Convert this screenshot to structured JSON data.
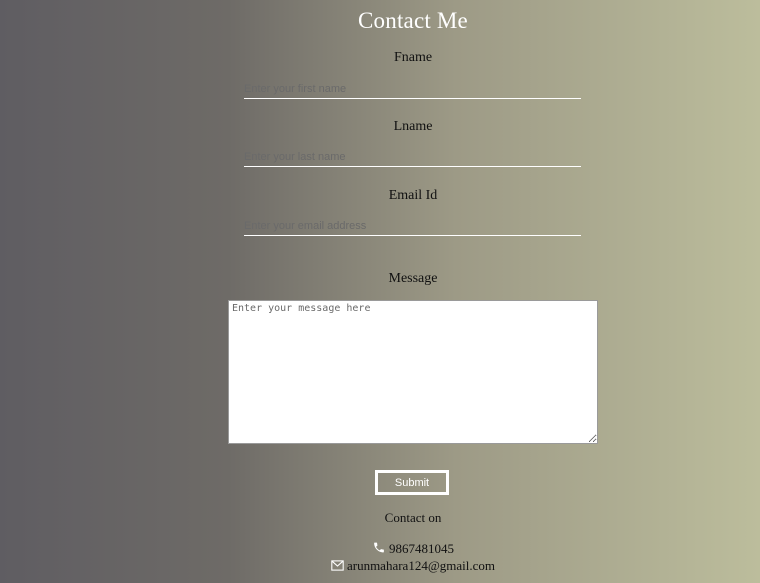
{
  "page": {
    "title": "Contact Me"
  },
  "form": {
    "fname_label": "Fname",
    "fname_placeholder": "Enter your first name",
    "lname_label": "Lname",
    "lname_placeholder": "Enter your last name",
    "email_label": "Email Id",
    "email_placeholder": "Enter your email address",
    "message_label": "Message",
    "message_placeholder": "Enter your message here",
    "submit_label": "Submit"
  },
  "contact": {
    "heading": "Contact on",
    "phone": "9867481045",
    "email": "arunmahara124@gmail.com",
    "phone_icon": "phone-icon",
    "email_icon": "envelope-icon"
  },
  "colors": {
    "gradient_left": "#5f5d62",
    "gradient_right": "#bcbd9c",
    "title": "#ffffff"
  }
}
